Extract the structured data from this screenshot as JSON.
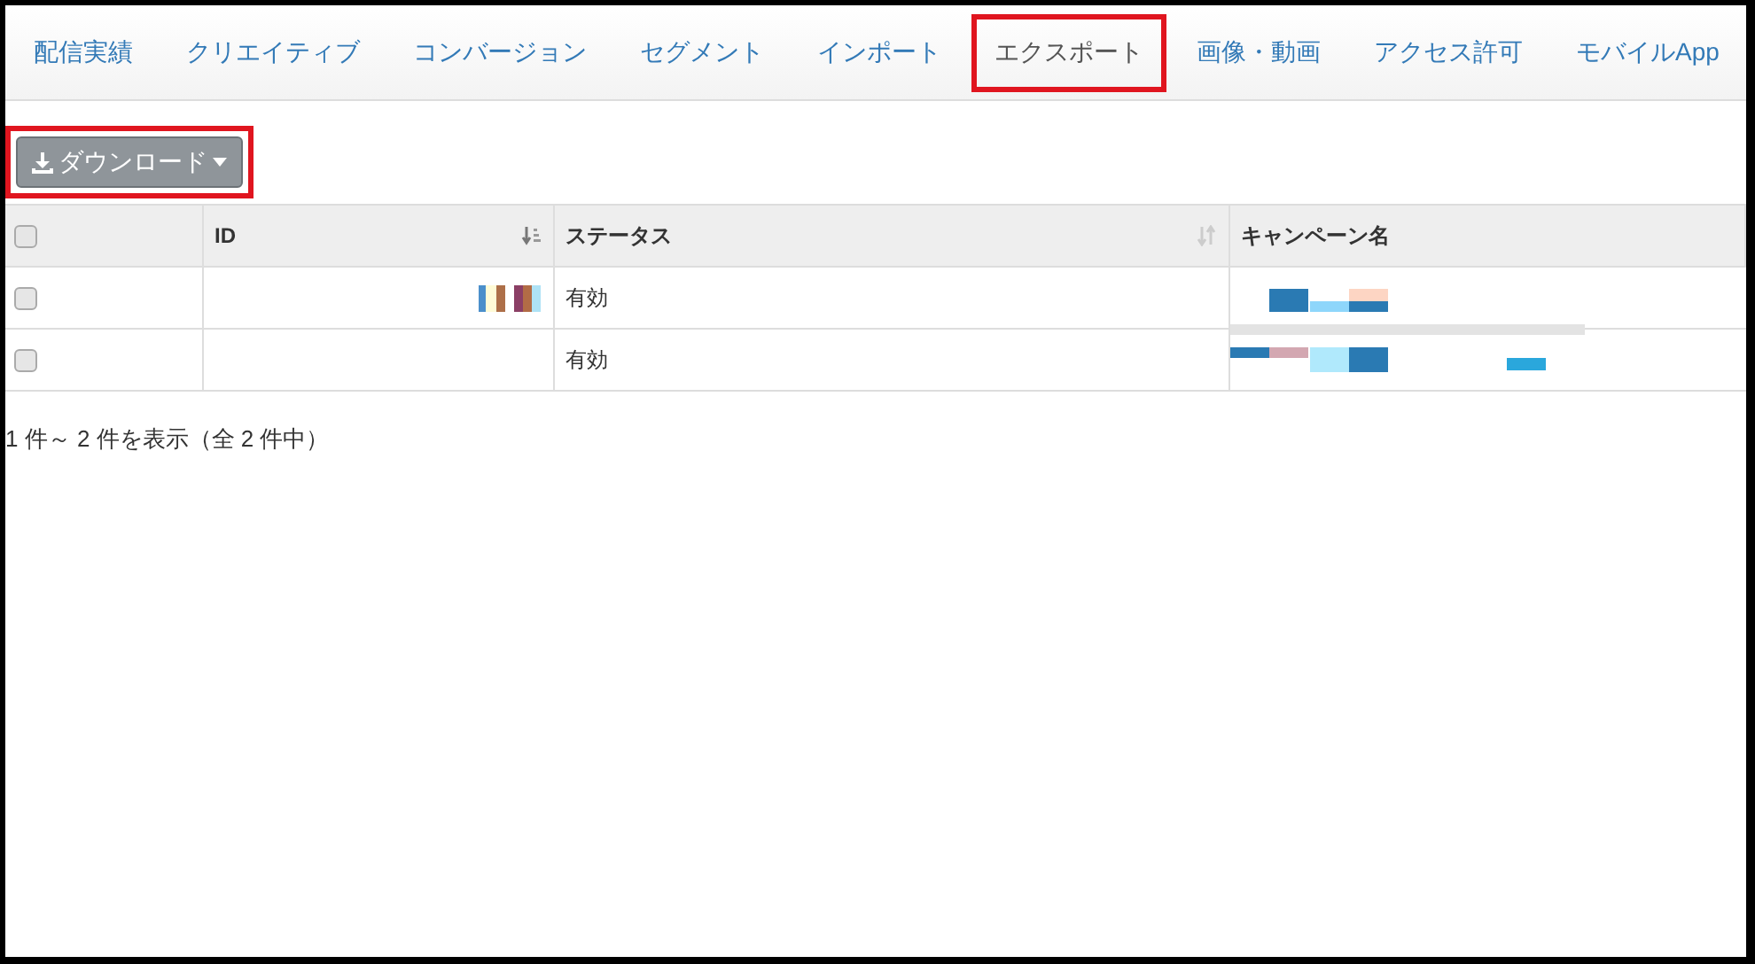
{
  "tabs": [
    {
      "label": "配信実績",
      "selected": false,
      "highlighted": false
    },
    {
      "label": "クリエイティブ",
      "selected": false,
      "highlighted": false
    },
    {
      "label": "コンバージョン",
      "selected": false,
      "highlighted": false
    },
    {
      "label": "セグメント",
      "selected": false,
      "highlighted": false
    },
    {
      "label": "インポート",
      "selected": false,
      "highlighted": false
    },
    {
      "label": "エクスポート",
      "selected": true,
      "highlighted": true
    },
    {
      "label": "画像・動画",
      "selected": false,
      "highlighted": false
    },
    {
      "label": "アクセス許可",
      "selected": false,
      "highlighted": false
    },
    {
      "label": "モバイルApp",
      "selected": false,
      "highlighted": false
    }
  ],
  "download_button": {
    "label": "ダウンロード",
    "highlighted": true
  },
  "table": {
    "header_checkbox": {
      "checked": false
    },
    "columns": [
      {
        "label": "ID",
        "kind": "sorted"
      },
      {
        "label": "ステータス",
        "kind": "sortable"
      },
      {
        "label": "キャンペーン名",
        "kind": "plain"
      }
    ],
    "rows": [
      {
        "checked": false,
        "status": "有効"
      },
      {
        "checked": false,
        "status": "有効"
      }
    ]
  },
  "footer": "1 件～ 2 件を表示（全 2 件中）"
}
